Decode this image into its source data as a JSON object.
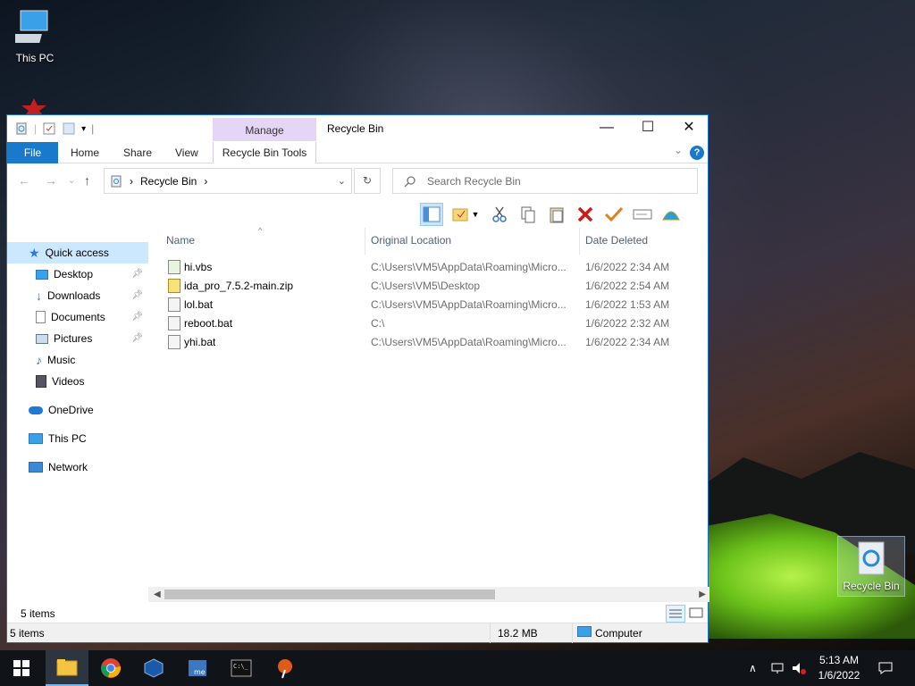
{
  "desktop": {
    "this_pc_label": "This PC",
    "recycle_bin_label": "Recycle Bin"
  },
  "window": {
    "title": "Recycle Bin",
    "manage_label": "Manage",
    "ribbon_tabs": [
      "File",
      "Home",
      "Share",
      "View",
      "Recycle Bin Tools"
    ],
    "help_label": "?"
  },
  "address": {
    "path_root": "›",
    "path_label": "Recycle Bin",
    "search_placeholder": "Search Recycle Bin"
  },
  "sidebar": {
    "items": [
      {
        "label": "Quick access",
        "icon": "star-icon"
      },
      {
        "label": "Desktop",
        "icon": "desktop-icon",
        "pinned": true
      },
      {
        "label": "Downloads",
        "icon": "download-icon",
        "pinned": true
      },
      {
        "label": "Documents",
        "icon": "documents-icon",
        "pinned": true
      },
      {
        "label": "Pictures",
        "icon": "pictures-icon",
        "pinned": true
      },
      {
        "label": "Music",
        "icon": "music-icon"
      },
      {
        "label": "Videos",
        "icon": "videos-icon"
      },
      {
        "label": "OneDrive",
        "icon": "onedrive-icon"
      },
      {
        "label": "This PC",
        "icon": "computer-icon"
      },
      {
        "label": "Network",
        "icon": "network-icon"
      }
    ]
  },
  "columns": {
    "name": "Name",
    "location": "Original Location",
    "date": "Date Deleted"
  },
  "files": [
    {
      "name": "hi.vbs",
      "location": "C:\\Users\\VM5\\AppData\\Roaming\\Micro...",
      "date": "1/6/2022 2:34 AM"
    },
    {
      "name": "ida_pro_7.5.2-main.zip",
      "location": "C:\\Users\\VM5\\Desktop",
      "date": "1/6/2022 2:54 AM"
    },
    {
      "name": "lol.bat",
      "location": "C:\\Users\\VM5\\AppData\\Roaming\\Micro...",
      "date": "1/6/2022 1:53 AM"
    },
    {
      "name": "reboot.bat",
      "location": "C:\\",
      "date": "1/6/2022 2:32 AM"
    },
    {
      "name": "yhi.bat",
      "location": "C:\\Users\\VM5\\AppData\\Roaming\\Micro...",
      "date": "1/6/2022 2:34 AM"
    }
  ],
  "status": {
    "items_count_top": "5 items",
    "items_count_bottom": "5 items",
    "size": "18.2 MB",
    "computer_label": "Computer"
  },
  "taskbar": {
    "time": "5:13 AM",
    "date": "1/6/2022"
  },
  "colors": {
    "accent": "#1979ca",
    "manage_tab": "#e6d6f5",
    "selection": "#cce8ff"
  }
}
